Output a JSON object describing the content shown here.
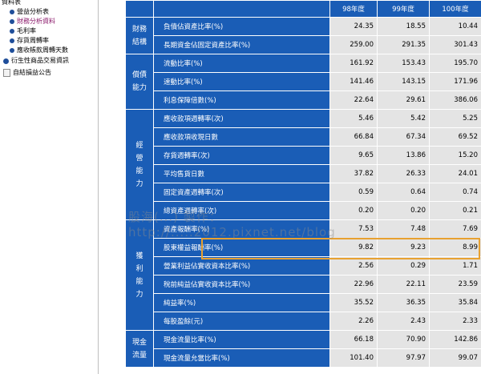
{
  "sidebar": {
    "items": [
      {
        "label": "資料表",
        "icon": "none",
        "active": false
      },
      {
        "label": "營益分析表",
        "icon": "bullet-icon",
        "active": false
      },
      {
        "label": "財務分析資料",
        "icon": "bullet-icon",
        "active": true
      },
      {
        "label": "毛利率",
        "icon": "bullet-icon",
        "active": false
      },
      {
        "label": "存貨周轉率",
        "icon": "bullet-icon",
        "active": false
      },
      {
        "label": "應收帳款周轉天數",
        "icon": "bullet-icon",
        "active": false
      },
      {
        "label": "衍生性商品交易資訊",
        "icon": "bullet-icon",
        "active": false
      },
      {
        "label": "自結損益公告",
        "icon": "document-icon",
        "active": false
      }
    ]
  },
  "table": {
    "headers": [
      "98年度",
      "99年度",
      "100年度"
    ],
    "groups": [
      {
        "category": "財務\n結構",
        "rows": [
          {
            "label": "負債佔資產比率(%)",
            "values": [
              "24.35",
              "18.55",
              "10.44"
            ]
          },
          {
            "label": "長期資金佔固定資產比率(%)",
            "values": [
              "259.00",
              "291.35",
              "301.43"
            ]
          }
        ]
      },
      {
        "category": "償債\n能力",
        "rows": [
          {
            "label": "流動比率(%)",
            "values": [
              "161.92",
              "153.43",
              "195.70"
            ]
          },
          {
            "label": "速動比率(%)",
            "values": [
              "141.46",
              "143.15",
              "171.96"
            ]
          },
          {
            "label": "利息保障倍數(%)",
            "values": [
              "22.64",
              "29.61",
              "386.06"
            ]
          }
        ]
      },
      {
        "category": "經\n營\n能\n力",
        "rows": [
          {
            "label": "應收款項週轉率(次)",
            "values": [
              "5.46",
              "5.42",
              "5.25"
            ]
          },
          {
            "label": "應收款項收現日數",
            "values": [
              "66.84",
              "67.34",
              "69.52"
            ]
          },
          {
            "label": "存貨週轉率(次)",
            "values": [
              "9.65",
              "13.86",
              "15.20"
            ]
          },
          {
            "label": "平均售貨日數",
            "values": [
              "37.82",
              "26.33",
              "24.01"
            ]
          },
          {
            "label": "固定資產週轉率(次)",
            "values": [
              "0.59",
              "0.64",
              "0.74"
            ]
          },
          {
            "label": "總資產週轉率(次)",
            "values": [
              "0.20",
              "0.20",
              "0.21"
            ]
          }
        ]
      },
      {
        "category": "獲\n利\n能\n力",
        "rows": [
          {
            "label": "資產報酬率(%)",
            "values": [
              "7.53",
              "7.48",
              "7.69"
            ]
          },
          {
            "label": "股東權益報酬率(%)",
            "values": [
              "9.82",
              "9.23",
              "8.99"
            ]
          },
          {
            "label": "營業利益佔實收資本比率(%)",
            "values": [
              "2.56",
              "0.29",
              "1.71"
            ]
          },
          {
            "label": "稅前純益佔實收資本比率(%)",
            "values": [
              "22.96",
              "22.11",
              "23.59"
            ]
          },
          {
            "label": "純益率(%)",
            "values": [
              "35.52",
              "36.35",
              "35.84"
            ]
          },
          {
            "label": "每股盈餘(元)",
            "values": [
              "2.26",
              "2.43",
              "2.33"
            ]
          }
        ]
      },
      {
        "category": "現金\n流量",
        "rows": [
          {
            "label": "現金流量比率(%)",
            "values": [
              "66.18",
              "70.90",
              "142.86"
            ]
          },
          {
            "label": "現金流量允當比率(%)",
            "values": [
              "101.40",
              "97.97",
              "99.07"
            ]
          }
        ]
      }
    ]
  },
  "watermark": {
    "line1": "股海(...)  製作：",
    "line2": "http://.....2012.pixnet.net/blog"
  },
  "colors": {
    "header_blue": "#1a5db6",
    "value_gray": "#e4e4e4",
    "highlight": "#e8a130",
    "active_link": "#8b1a6b"
  }
}
